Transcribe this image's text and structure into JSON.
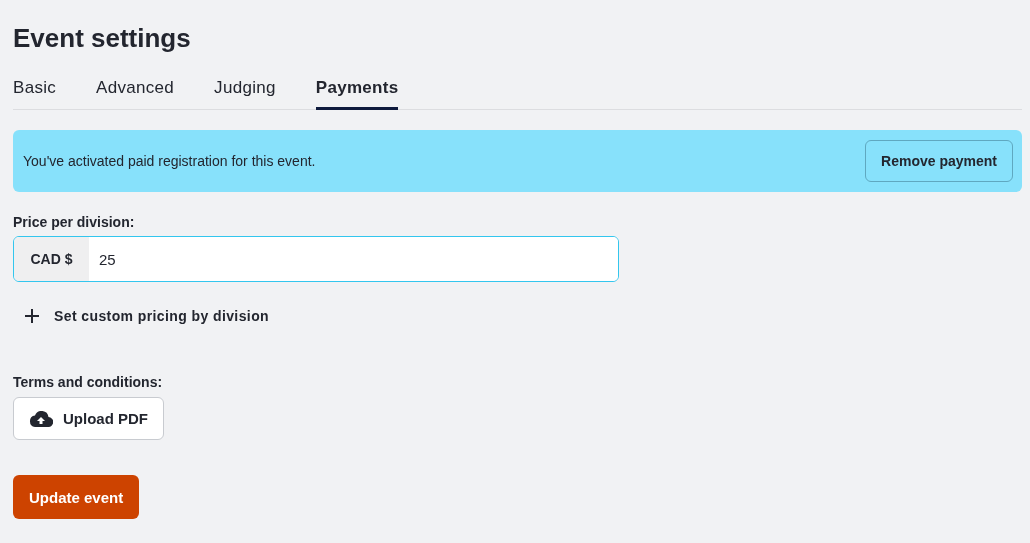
{
  "page": {
    "title": "Event settings"
  },
  "tabs": [
    {
      "label": "Basic",
      "selected": false
    },
    {
      "label": "Advanced",
      "selected": false
    },
    {
      "label": "Judging",
      "selected": false
    },
    {
      "label": "Payments",
      "selected": true
    }
  ],
  "notice": {
    "text": "You've activated paid registration for this event.",
    "button": "Remove payment"
  },
  "price": {
    "label": "Price per division:",
    "prefix": "CAD $",
    "value": "25",
    "focused": true
  },
  "custom_pricing": {
    "label": "Set custom pricing by division"
  },
  "terms": {
    "label": "Terms and conditions:",
    "button": "Upload PDF"
  },
  "submit": {
    "label": "Update event"
  }
}
